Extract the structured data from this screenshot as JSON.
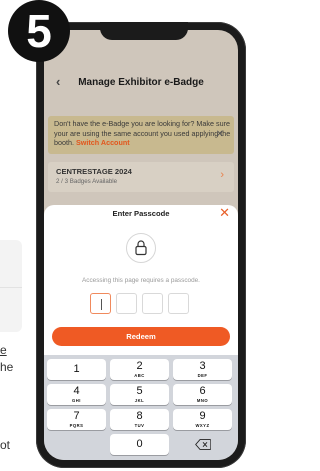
{
  "step_badge": "5",
  "app": {
    "title": "Manage Exhibitor e-Badge",
    "back_icon": "chevron-left-icon"
  },
  "notice": {
    "text": "Don't have the e-Badge you are looking for? Make sure your are using the same account you used applying the booth.",
    "link": "Switch Account",
    "close_icon": "close-icon"
  },
  "event": {
    "name": "CENTRESTAGE 2024",
    "subtitle": "2 / 3 Badges Available",
    "chevron_icon": "chevron-right-icon"
  },
  "passcode_modal": {
    "title": "Enter Passcode",
    "close_icon": "close-icon",
    "lock_icon": "lock-icon",
    "description": "Accessing this page requires a passcode.",
    "box_count": 4,
    "redeem_label": "Redeem"
  },
  "keypad": {
    "rows": [
      [
        {
          "digit": "1",
          "letters": ""
        },
        {
          "digit": "2",
          "letters": "ABC"
        },
        {
          "digit": "3",
          "letters": "DEF"
        }
      ],
      [
        {
          "digit": "4",
          "letters": "GHI"
        },
        {
          "digit": "5",
          "letters": "JKL"
        },
        {
          "digit": "6",
          "letters": "MNO"
        }
      ],
      [
        {
          "digit": "7",
          "letters": "PQRS"
        },
        {
          "digit": "8",
          "letters": "TUV"
        },
        {
          "digit": "9",
          "letters": "WXYZ"
        }
      ]
    ],
    "zero": "0",
    "delete_icon": "backspace-icon"
  },
  "background_text": {
    "line1": "e",
    "line2": "he",
    "line3": "ot"
  },
  "colors": {
    "accent": "#ef5a24",
    "overlay": "#cfc6bb",
    "keypad_bg": "#d2d5db"
  }
}
